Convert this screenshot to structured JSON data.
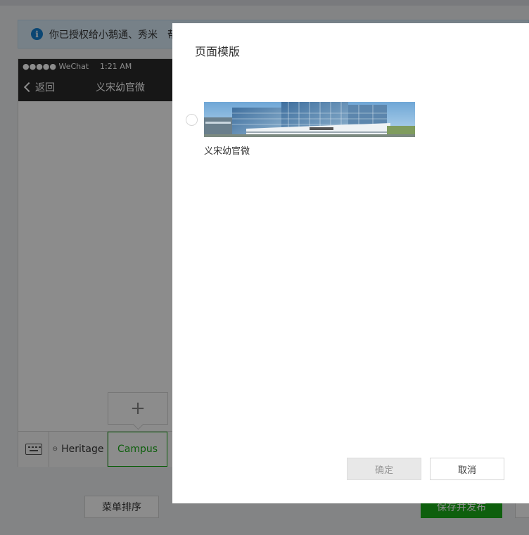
{
  "notice": {
    "text": "你已授权给小鹅通、秀米　帮"
  },
  "phone": {
    "status_carrier": "●●●●● WeChat",
    "status_time": "1:21 AM",
    "back_label": "返回",
    "account_title": "义宋幼官微",
    "add_symbol": "+",
    "menu": [
      {
        "label": "Heritage"
      },
      {
        "label": "Campus"
      }
    ]
  },
  "page_buttons": {
    "sort_label": "菜单排序",
    "publish_label": "保存并发布"
  },
  "dialog": {
    "title": "页面模版",
    "template": {
      "name": "义宋幼官微",
      "selected": false
    },
    "ok_label": "确定",
    "cancel_label": "取消"
  },
  "colors": {
    "accent": "#1aad19",
    "info": "#1480d1",
    "navbar": "#2b2b2b"
  }
}
